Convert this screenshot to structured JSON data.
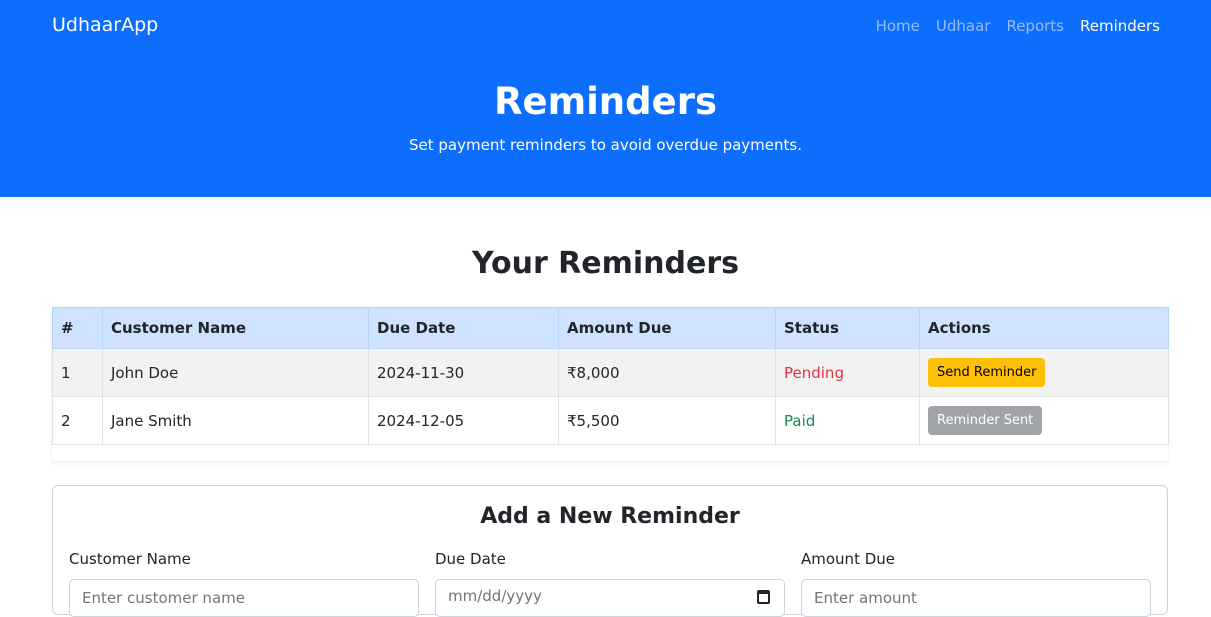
{
  "navbar": {
    "brand": "UdhaarApp",
    "links": [
      {
        "label": "Home",
        "active": false
      },
      {
        "label": "Udhaar",
        "active": false
      },
      {
        "label": "Reports",
        "active": false
      },
      {
        "label": "Reminders",
        "active": true
      }
    ]
  },
  "hero": {
    "title": "Reminders",
    "subtitle": "Set payment reminders to avoid overdue payments."
  },
  "reminders": {
    "title": "Your Reminders",
    "columns": [
      "#",
      "Customer Name",
      "Due Date",
      "Amount Due",
      "Status",
      "Actions"
    ],
    "rows": [
      {
        "num": "1",
        "customer": "John Doe",
        "due": "2024-11-30",
        "amount": "₹8,000",
        "status": "Pending",
        "action": "Send Reminder"
      },
      {
        "num": "2",
        "customer": "Jane Smith",
        "due": "2024-12-05",
        "amount": "₹5,500",
        "status": "Paid",
        "action": "Reminder Sent"
      }
    ]
  },
  "form": {
    "title": "Add a New Reminder",
    "customer_label": "Customer Name",
    "customer_placeholder": "Enter customer name",
    "due_label": "Due Date",
    "due_placeholder": "mm/dd/yyyy",
    "amount_label": "Amount Due",
    "amount_placeholder": "Enter amount"
  },
  "colors": {
    "primary": "#0d6efd",
    "warning": "#ffc107",
    "danger": "#dc3545",
    "success": "#198754",
    "table_header": "#cfe2ff"
  }
}
